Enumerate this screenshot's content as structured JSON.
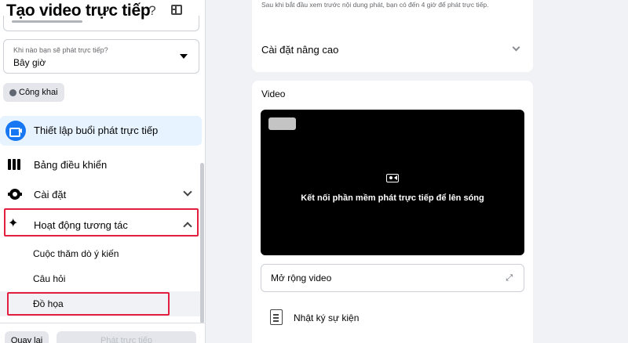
{
  "sidebar": {
    "title": "Tạo video trực tiếp",
    "help_icon": "?",
    "when_field": {
      "label": "Khi nào bạn sẽ phát trực tiếp?",
      "value": "Bây giờ"
    },
    "privacy_label": "Công khai",
    "nav": [
      {
        "label": "Thiết lập buổi phát trực tiếp",
        "icon": "video-camera-icon",
        "active": true
      },
      {
        "label": "Bảng điều khiển",
        "icon": "columns-icon"
      },
      {
        "label": "Cài đặt",
        "icon": "gear-icon"
      },
      {
        "label": "Hoạt động tương tác",
        "icon": "sparkle-icon",
        "expanded": true
      }
    ],
    "sub_items": [
      {
        "label": "Cuộc thăm dò ý kiến"
      },
      {
        "label": "Câu hỏi"
      },
      {
        "label": "Đồ họa",
        "highlighted": true
      }
    ],
    "footer": {
      "back_label": "Quay lại",
      "go_live_label": "Phát trực tiếp"
    },
    "highlight_color": "#e41e3f",
    "accent_color": "#1877f2"
  },
  "main": {
    "top_card": {
      "note": "Sau khi bắt đầu xem trước nội dung phát, bạn có đến 4 giờ để phát trực tiếp.",
      "advanced_label": "Cài đặt nâng cao"
    },
    "video_card": {
      "heading": "Video",
      "message": "Kết nối phần mềm phát trực tiếp để lên sóng",
      "expand_label": "Mở rộng video",
      "expand_icon": "⤢",
      "log_label": "Nhật ký sự kiện"
    }
  }
}
